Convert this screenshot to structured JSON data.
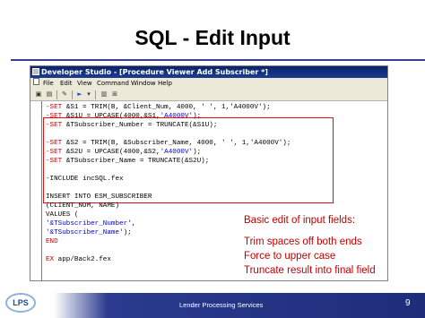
{
  "slide": {
    "title": "SQL - Edit Input",
    "annotation_lines": [
      "Basic edit of input fields:",
      "Trim spaces off both ends",
      "Force to upper case",
      "Truncate result into final field"
    ],
    "footer_text": "Lender Processing Services",
    "page_number": "9",
    "logo_text": "LPS"
  },
  "window": {
    "title": "Developer Studio - [Procedure Viewer Add Subscriber *]",
    "menu": [
      "File",
      "Edit",
      "View",
      "Command",
      "Window",
      "Help"
    ]
  },
  "code": [
    {
      "kw": "-SET",
      "rest": " &S1 = TRIM(B, &Client_Num, 4000, ' ', 1,'A4000V');",
      "str": ""
    },
    {
      "kw": "-SET",
      "rest": " &S1U = UPCASE(4000,&S1,",
      "str": "'A4000V'",
      "tail": ");"
    },
    {
      "kw": "-SET",
      "rest": " &TSubscriber_Number = TRUNCATE(&S1U);",
      "str": ""
    },
    {
      "kw": "",
      "rest": "",
      "str": ""
    },
    {
      "kw": "-SET",
      "rest": " &S2 = TRIM(B, &Subscriber_Name, 4000, ' ', 1,'A4000V');",
      "str": ""
    },
    {
      "kw": "-SET",
      "rest": " &S2U = UPCASE(4000,&S2,",
      "str": "'A4000V'",
      "tail": ");"
    },
    {
      "kw": "-SET",
      "rest": " &TSubscriber_Name = TRUNCATE(&S2U);",
      "str": ""
    },
    {
      "kw": "",
      "rest": "",
      "str": ""
    },
    {
      "kw": "",
      "rest": "-INCLUDE incSQL.fex",
      "str": ""
    },
    {
      "kw": "",
      "rest": "",
      "str": ""
    },
    {
      "kw": "",
      "rest": "INSERT INTO ESM_SUBSCRIBER",
      "str": ""
    },
    {
      "kw": "",
      "rest": "(CLIENT_NUM, NAME)",
      "str": ""
    },
    {
      "kw": "",
      "rest": "VALUES (",
      "str": ""
    },
    {
      "kw": "",
      "rest": "",
      "str": "'&TSubscriber_Number'",
      "tail": ","
    },
    {
      "kw": "",
      "rest": "",
      "str": "'&TSubscriber_Name'",
      "tail": ");"
    },
    {
      "kw": "",
      "rest": "END",
      "str": ""
    },
    {
      "kw": "",
      "rest": "",
      "str": ""
    },
    {
      "kw": "EX",
      "rest": " app/Back2.fex",
      "str": ""
    }
  ],
  "colors": {
    "keyword": "#cc0000",
    "string": "#0000cc",
    "highlight_box": "#e01010",
    "annotation": "#c00000",
    "footer": "#1e2d7a"
  }
}
